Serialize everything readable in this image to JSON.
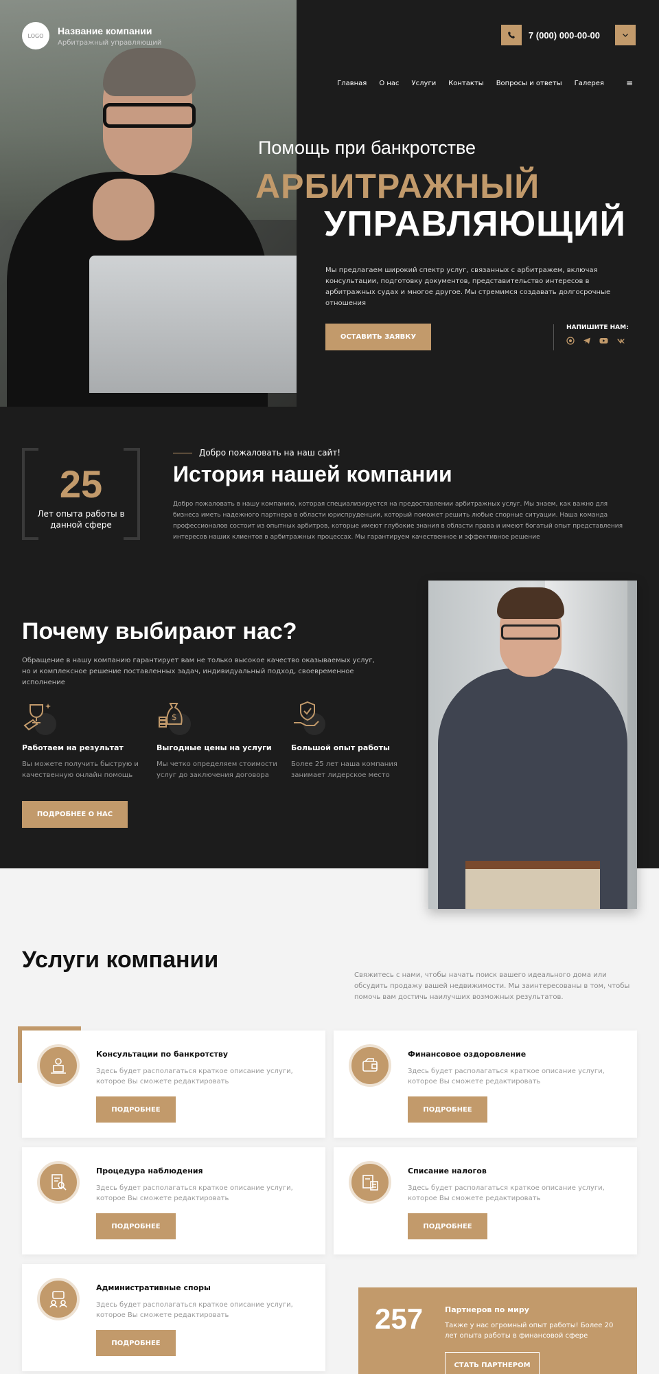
{
  "header": {
    "logo_text": "LOGO",
    "company_name": "Название компании",
    "company_sub": "Арбитражный управляющий",
    "phone": "7 (000) 000-00-00",
    "phone_icon": "phone-icon",
    "menu_icon": "chevron-down-icon"
  },
  "nav": {
    "items": [
      "Главная",
      "О нас",
      "Услуги",
      "Контакты",
      "Вопросы и ответы",
      "Галерея"
    ],
    "burger": "≡"
  },
  "hero": {
    "subtitle": "Помощь при банкротстве",
    "title_line1": "АРБИТРАЖНЫЙ",
    "title_line2": "УПРАВЛЯЮЩИЙ",
    "description": "Мы предлагаем широкий спектр услуг, связанных с арбитражем, включая консультации, подготовку документов, представительство интересов в арбитражных судах и многое другое. Мы стремимся создавать долгосрочные отношения",
    "cta": "ОСТАВИТЬ ЗАЯВКУ",
    "write_us": "НАПИШИТЕ НАМ:",
    "socials": [
      "whatsapp-icon",
      "telegram-icon",
      "youtube-icon",
      "vk-icon"
    ]
  },
  "history": {
    "years": "25",
    "years_label": "Лет опыта работы в данной сфере",
    "welcome": "Добро пожаловать на наш сайт!",
    "title": "История нашей компании",
    "description": "Добро пожаловать в нашу компанию, которая специализируется на предоставлении арбитражных услуг. Мы знаем, как важно для бизнеса иметь надежного партнера в области юриспруденции, который поможет решить любые спорные ситуации. Наша команда профессионалов состоит из опытных арбитров, которые имеют глубокие знания в области права и имеют богатый опыт представления интересов наших клиентов в арбитражных процессах. Мы гарантируем качественное и эффективное решение"
  },
  "why": {
    "title": "Почему выбирают нас?",
    "description": "Обращение в нашу компанию гарантирует вам не только высокое качество оказываемых услуг, но и комплексное решение поставленных задач, индивидуальный подход, своевременное исполнение",
    "features": [
      {
        "title": "Работаем на результат",
        "text": "Вы можете получить быструю и качественную онлайн помощь",
        "icon": "trophy-icon"
      },
      {
        "title": "Выгодные цены на услуги",
        "text": "Мы четко определяем стоимости услуг до заключения договора",
        "icon": "money-bag-icon"
      },
      {
        "title": "Большой опыт работы",
        "text": "Более 25 лет наша компания занимает лидерское место",
        "icon": "shield-hand-icon"
      }
    ],
    "button": "ПОДРОБНЕЕ О НАС"
  },
  "services": {
    "title": "Услуги компании",
    "description": "Свяжитесь с нами, чтобы начать поиск вашего идеального дома или обсудить продажу вашей недвижимости. Мы заинтересованы в том, чтобы помочь вам достичь наилучших возможных результатов.",
    "items": [
      {
        "title": "Консультации по банкротству",
        "text": "Здесь будет располагаться краткое описание услуги, которое Вы сможете редактировать",
        "button": "ПОДРОБНЕЕ",
        "icon": "consultation-icon"
      },
      {
        "title": "Финансовое оздоровление",
        "text": "Здесь будет располагаться краткое описание услуги, которое Вы сможете редактировать",
        "button": "ПОДРОБНЕЕ",
        "icon": "wallet-icon"
      },
      {
        "title": "Процедура наблюдения",
        "text": "Здесь будет располагаться краткое описание услуги, которое Вы сможете редактировать",
        "button": "ПОДРОБНЕЕ",
        "icon": "document-search-icon"
      },
      {
        "title": "Списание налогов",
        "text": "Здесь будет располагаться краткое описание услуги, которое Вы сможете редактировать",
        "button": "ПОДРОБНЕЕ",
        "icon": "tax-calculator-icon"
      },
      {
        "title": "Административные споры",
        "text": "Здесь будет располагаться краткое описание услуги, которое Вы сможете редактировать",
        "button": "ПОДРОБНЕЕ",
        "icon": "dispute-icon"
      }
    ]
  },
  "partners": {
    "number": "257",
    "title": "Партнеров по миру",
    "text": "Также у нас огромный опыт работы! Более 20 лет опыта работы в финансовой сфере",
    "button": "СТАТЬ ПАРТНЕРОМ"
  },
  "colors": {
    "accent": "#c29a6b",
    "dark": "#1c1c1c",
    "light": "#f3f3f3"
  }
}
